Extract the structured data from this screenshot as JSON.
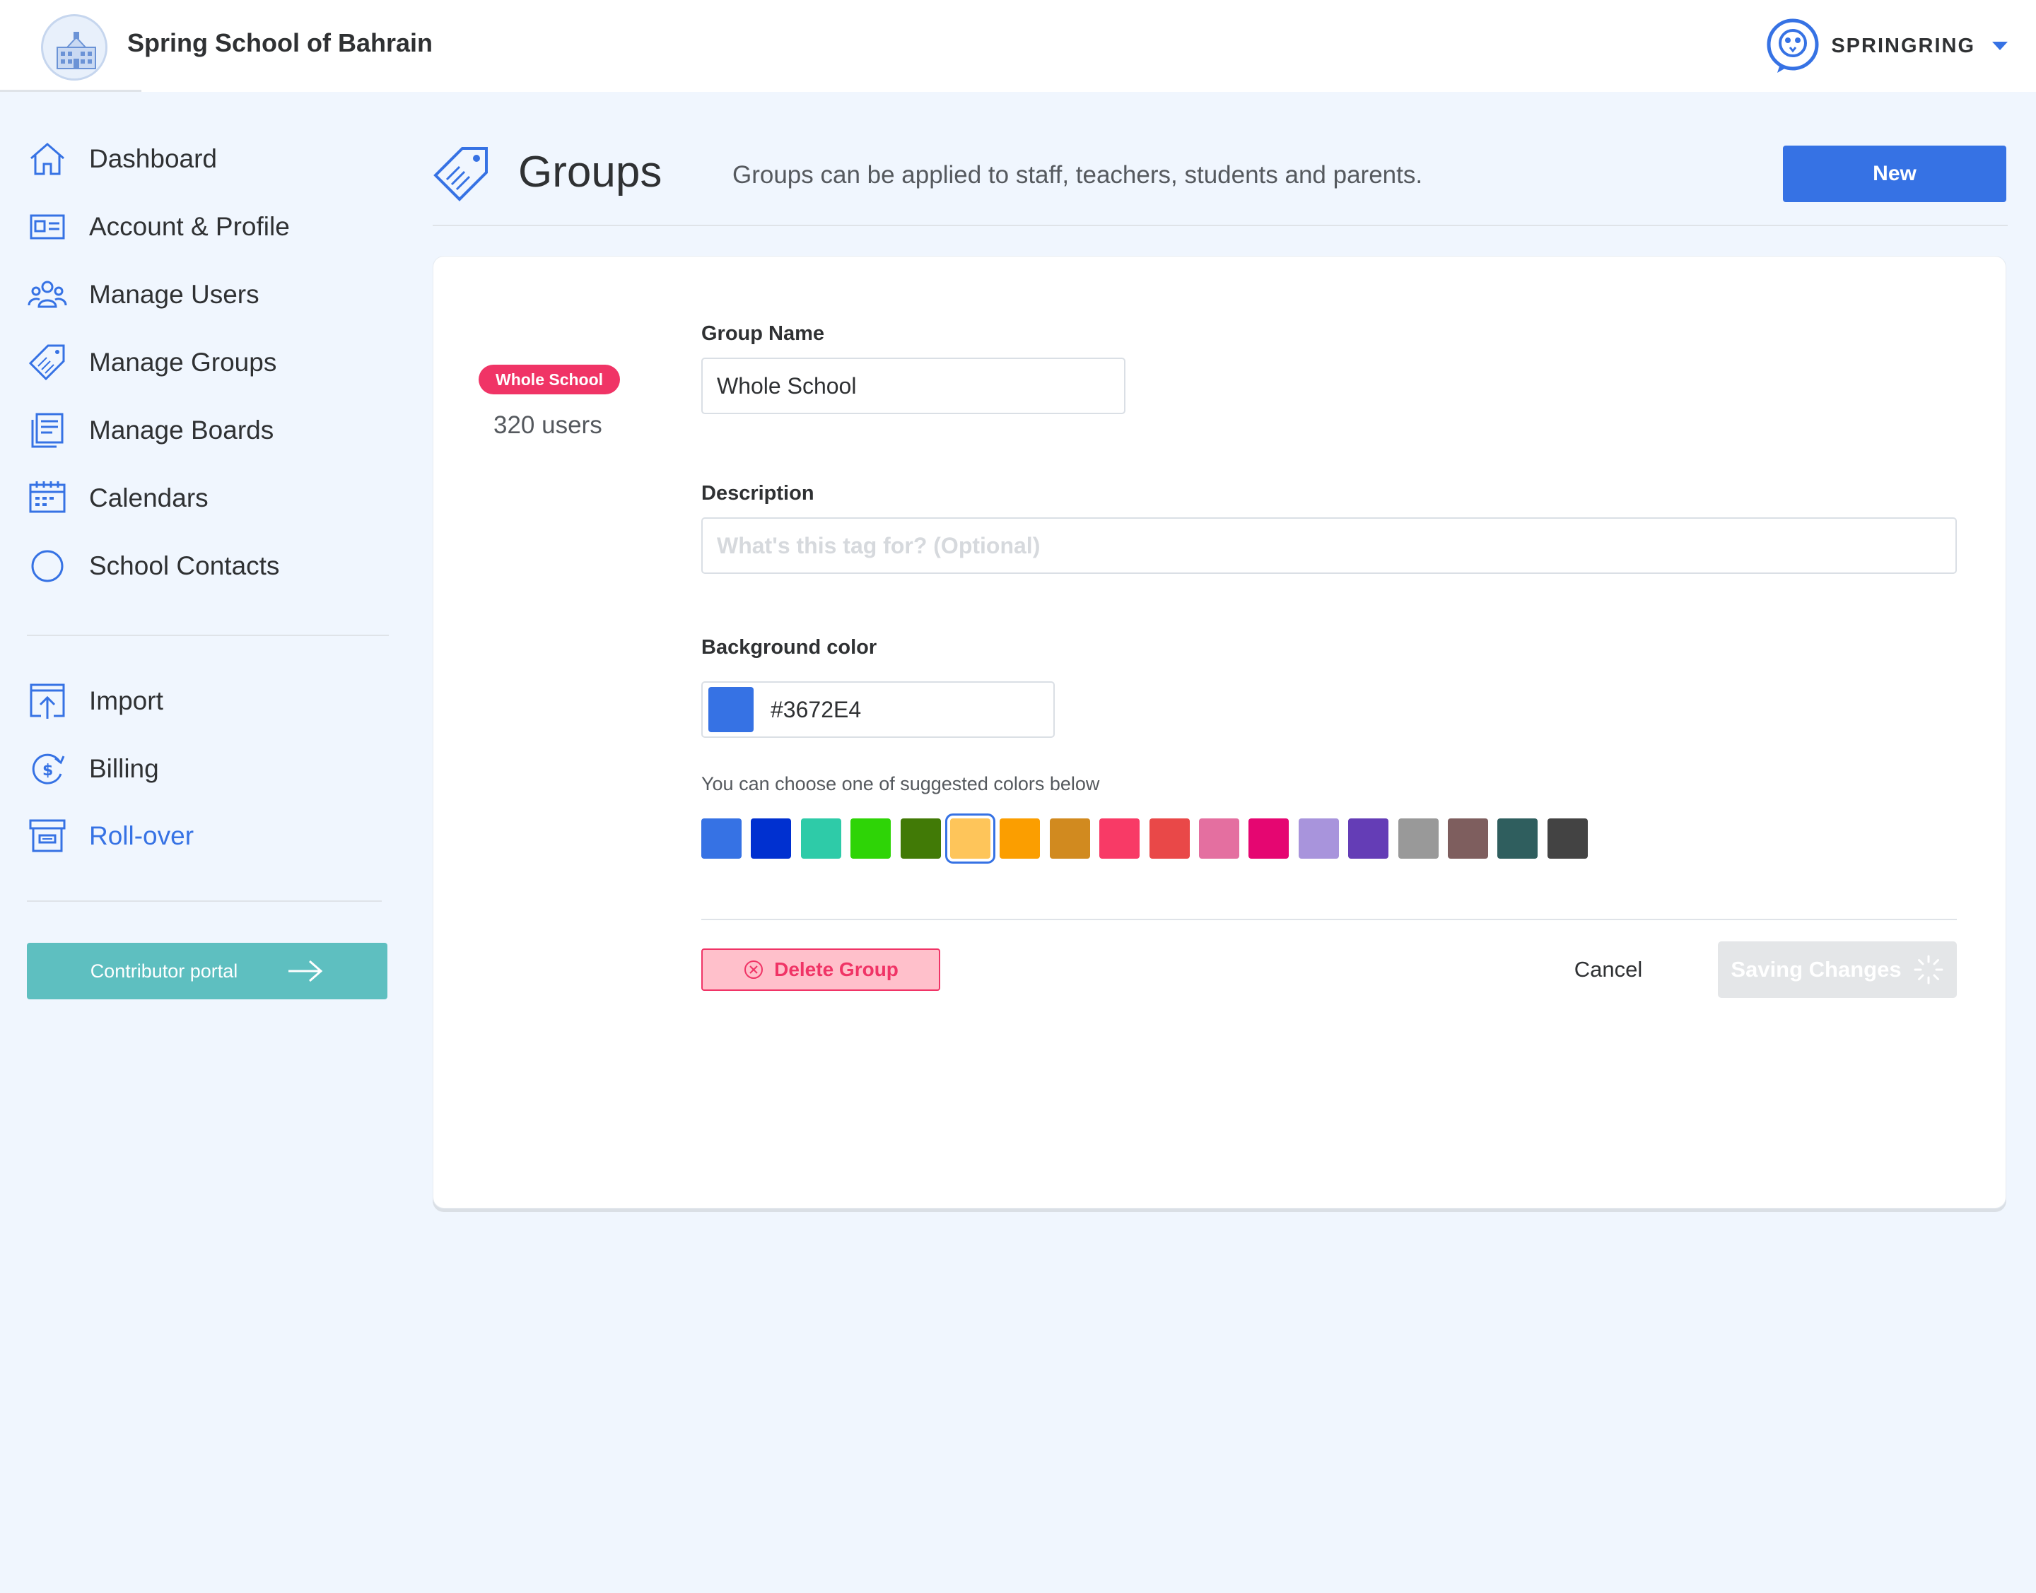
{
  "header": {
    "school_name": "Spring School of Bahrain",
    "brand_name": "SPRINGRING",
    "school_logo_icon": "school-building-icon",
    "brand_logo_icon": "owl-speech-bubble-icon"
  },
  "sidebar": {
    "items": [
      {
        "label": "Dashboard",
        "icon": "home-icon"
      },
      {
        "label": "Account & Profile",
        "icon": "id-card-icon"
      },
      {
        "label": "Manage Users",
        "icon": "users-icon"
      },
      {
        "label": "Manage Groups",
        "icon": "tag-icon"
      },
      {
        "label": "Manage Boards",
        "icon": "board-icon"
      },
      {
        "label": "Calendars",
        "icon": "calendar-icon"
      },
      {
        "label": "School Contacts",
        "icon": "circle-icon"
      }
    ],
    "secondary_items": [
      {
        "label": "Import",
        "icon": "upload-icon"
      },
      {
        "label": "Billing",
        "icon": "billing-icon"
      },
      {
        "label": "Roll-over",
        "icon": "archive-box-icon",
        "active": true
      }
    ],
    "contributor_portal_label": "Contributor portal"
  },
  "page": {
    "title": "Groups",
    "subtitle": "Groups can be applied to staff, teachers, students and parents.",
    "new_button": "New"
  },
  "group": {
    "badge_label": "Whole School",
    "badge_color": "#F03466",
    "user_count": "320 users"
  },
  "form": {
    "name_label": "Group Name",
    "name_value": "Whole School",
    "description_label": "Description",
    "description_placeholder": "What's this tag for? (Optional)",
    "background_label": "Background color",
    "background_value": "#3672E4",
    "hint": "You can choose one of suggested colors below",
    "suggested_colors": [
      "#3672E4",
      "#0030D0",
      "#2ECBA8",
      "#2ED406",
      "#417A06",
      "#FEC55A",
      "#FB9E00",
      "#D18A1F",
      "#F83A66",
      "#E94848",
      "#E46FA0",
      "#E50671",
      "#A894DC",
      "#643DB6",
      "#999999",
      "#7E5E5E",
      "#2F5E5E",
      "#434343"
    ],
    "selected_color_index": 5,
    "delete_label": "Delete Group",
    "cancel_label": "Cancel",
    "save_label": "Saving Changes"
  },
  "colors": {
    "accent": "#3672E4",
    "contributor": "#5EBFC0",
    "danger": "#F03466"
  }
}
